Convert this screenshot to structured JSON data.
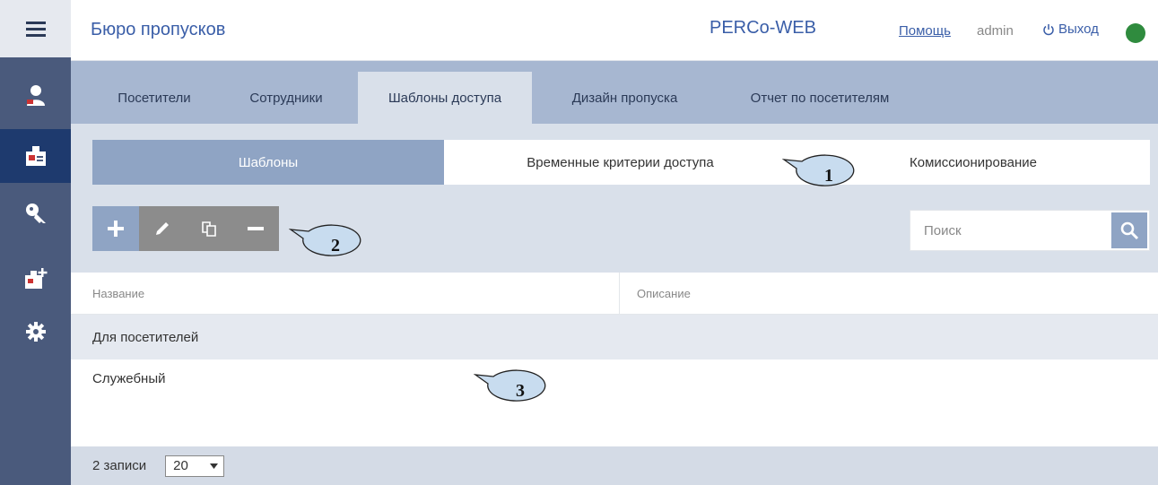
{
  "header": {
    "app_title": "Бюро пропусков",
    "brand": "PERCo-WEB",
    "help": "Помощь",
    "user": "admin",
    "logout": "Выход",
    "status_color": "#2f8b3e"
  },
  "sidebar": {
    "items": [
      {
        "icon": "visitor-icon"
      },
      {
        "icon": "badge-icon",
        "active": true
      },
      {
        "icon": "key-icon"
      },
      {
        "icon": "badge-add-icon"
      },
      {
        "icon": "gear-icon"
      }
    ]
  },
  "tabs": [
    {
      "label": "Посетители"
    },
    {
      "label": "Сотрудники"
    },
    {
      "label": "Шаблоны доступа",
      "active": true
    },
    {
      "label": "Дизайн пропуска"
    },
    {
      "label": "Отчет по посетителям"
    }
  ],
  "subtabs": [
    {
      "label": "Шаблоны",
      "active": true
    },
    {
      "label": "Временные критерии доступа"
    },
    {
      "label": "Комиссионирование"
    }
  ],
  "toolbar": {
    "buttons": [
      "plus-icon",
      "pencil-icon",
      "copy-icon",
      "minus-icon"
    ]
  },
  "search": {
    "placeholder": "Поиск",
    "value": ""
  },
  "table": {
    "columns": [
      "Название",
      "Описание"
    ],
    "rows": [
      [
        "Для посетителей",
        ""
      ],
      [
        "Служебный",
        ""
      ]
    ]
  },
  "footer": {
    "records": "2 записи",
    "page_size": "20"
  },
  "callouts": [
    "1",
    "2",
    "3"
  ],
  "colors": {
    "sidebar": "#4a5a7c",
    "sidebar_active": "#1e3a6e",
    "accent": "#3a5ea8",
    "tab_bar": "#a7b7d1",
    "active_subtab": "#8fa4c4",
    "tool_gray": "#8c8c8c",
    "callout_fill": "#c8dcef"
  }
}
